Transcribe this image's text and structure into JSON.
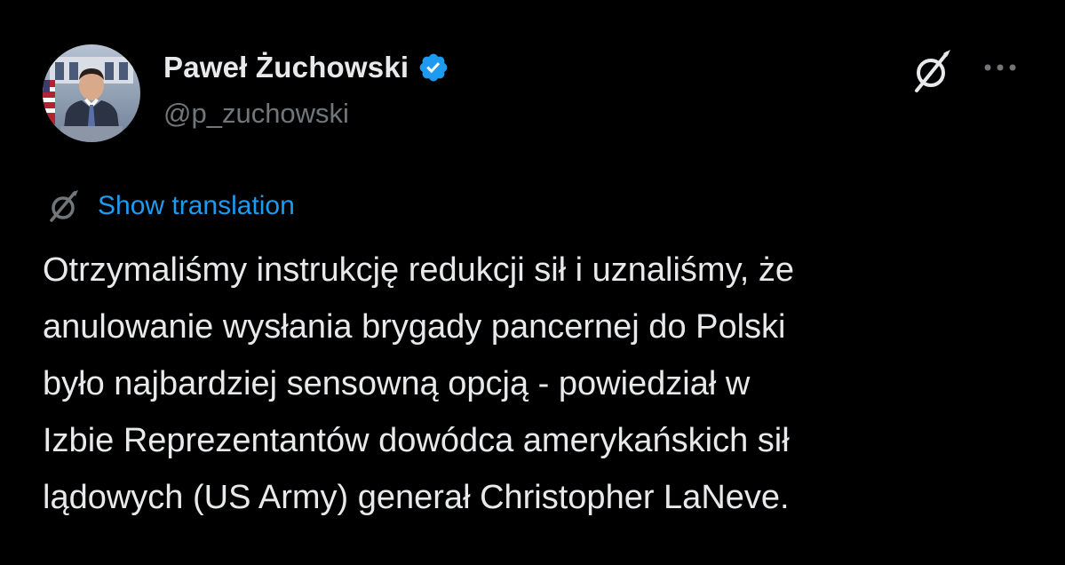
{
  "author": {
    "display_name": "Paweł Żuchowski",
    "handle": "@p_zuchowski",
    "verified": true
  },
  "icons": {
    "verified": "verified-badge-icon",
    "grok": "grok-icon",
    "more": "more-options-icon",
    "translate": "translate-icon"
  },
  "colors": {
    "background": "#000000",
    "primary_text": "#e7e9ea",
    "secondary_text": "#71767b",
    "link": "#1d9bf0",
    "verified_badge": "#1d9bf0"
  },
  "translate": {
    "label": "Show translation"
  },
  "tweet": {
    "lines": [
      "Otrzymaliśmy instrukcję redukcji sił i uznaliśmy, że",
      "anulowanie wysłania brygady pancernej do Polski",
      "było najbardziej sensowną opcją - powiedział w",
      "Izbie Reprezentantów dowódca amerykańskich sił",
      "lądowych (US Army) generał Christopher LaNeve."
    ]
  }
}
